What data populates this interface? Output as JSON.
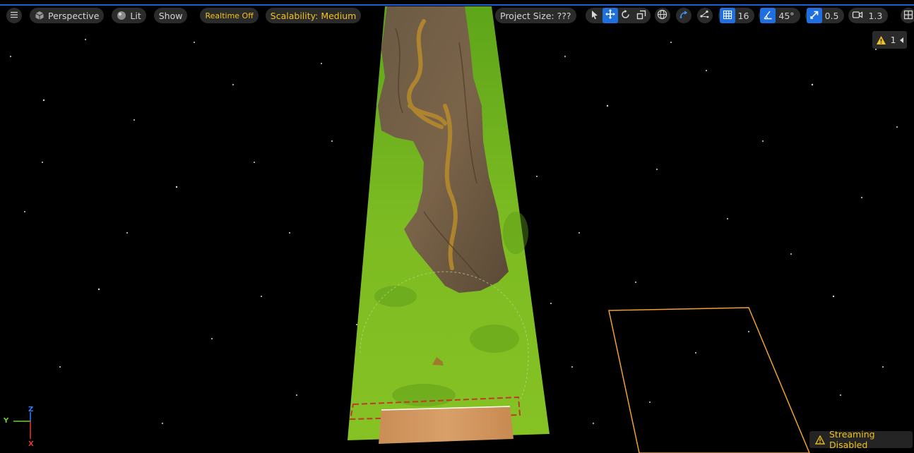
{
  "toolbar": {
    "menu_icon": "hamburger-menu-icon",
    "perspective_label": "Perspective",
    "lit_label": "Lit",
    "show_label": "Show",
    "realtime_label": "Realtime Off",
    "scalability_label": "Scalability: Medium",
    "project_size_label": "Project Size: ???",
    "grid_snap_value": "16",
    "angle_snap_value": "45°",
    "scale_snap_value": "0.5",
    "camera_speed_value": "1.3"
  },
  "warnings": {
    "count": "1"
  },
  "status": {
    "streaming_label": "Streaming Disabled"
  },
  "axes": {
    "z": "Z",
    "y": "Y",
    "x": "X"
  },
  "colors": {
    "accent": "#1f6fe0",
    "warning": "#f1c21b",
    "ground": "#7bb821",
    "selection": "#f0a030"
  }
}
